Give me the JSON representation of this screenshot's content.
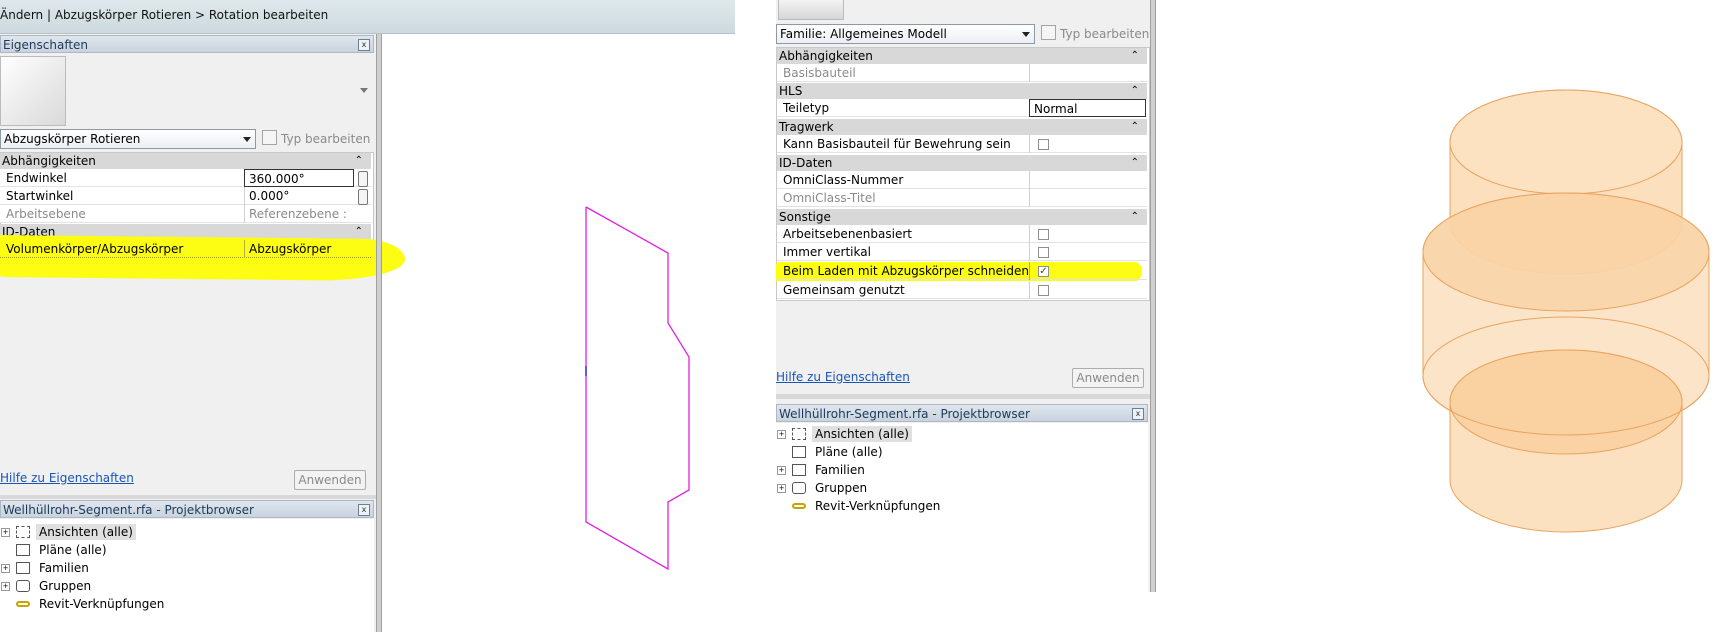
{
  "left_window": {
    "title": "Ändern | Abzugskörper Rotieren > Rotation bearbeiten",
    "properties_header": "Eigenschaften",
    "type_selector": "Abzugskörper Rotieren",
    "edit_type": "Typ bearbeiten",
    "groups": {
      "constraints": "Abhängigkeiten",
      "id_data": "ID-Daten"
    },
    "params": {
      "end_angle": {
        "label": "Endwinkel",
        "value": "360.000°"
      },
      "start_angle": {
        "label": "Startwinkel",
        "value": "0.000°"
      },
      "work_plane": {
        "label": "Arbeitsebene",
        "value": "Referenzebene : M..."
      },
      "solid_void": {
        "label": "Volumenkörper/Abzugskörper",
        "value": "Abzugskörper"
      }
    },
    "help_link": "Hilfe zu Eigenschaften",
    "apply": "Anwenden",
    "browser_header": "Wellhüllrohr-Segment.rfa - Projektbrowser",
    "tree": [
      "Ansichten (alle)",
      "Pläne (alle)",
      "Familien",
      "Gruppen",
      "Revit-Verknüpfungen"
    ]
  },
  "right_window": {
    "type_selector": "Familie: Allgemeines Modell",
    "edit_type": "Typ bearbeiten",
    "groups": {
      "constraints": "Abhängigkeiten",
      "mep": "HLS",
      "structure": "Tragwerk",
      "id_data": "ID-Daten",
      "other": "Sonstige"
    },
    "params": {
      "host": {
        "label": "Basisbauteil",
        "value": ""
      },
      "part_type": {
        "label": "Teiletyp",
        "value": "Normal"
      },
      "rebar_host": {
        "label": "Kann Basisbauteil für Bewehrung sein",
        "checked": false
      },
      "omniclass_number": {
        "label": "OmniClass-Nummer",
        "value": ""
      },
      "omniclass_title": {
        "label": "OmniClass-Titel",
        "value": ""
      },
      "workplane_based": {
        "label": "Arbeitsebenenbasiert",
        "checked": false
      },
      "always_vertical": {
        "label": "Immer vertikal",
        "checked": false
      },
      "cut_with_voids": {
        "label": "Beim Laden mit Abzugskörper schneiden",
        "checked": true
      },
      "shared": {
        "label": "Gemeinsam genutzt",
        "checked": false
      }
    },
    "help_link": "Hilfe zu Eigenschaften",
    "apply": "Anwenden",
    "browser_header": "Wellhüllrohr-Segment.rfa - Projektbrowser",
    "tree": [
      "Ansichten (alle)",
      "Pläne (alle)",
      "Familien",
      "Gruppen",
      "Revit-Verknüpfungen"
    ]
  },
  "colors": {
    "highlight": "#fdfd14",
    "sketch_line": "#e020e0",
    "solid_fill": "#fbd9b0",
    "solid_edge": "#e8a35f"
  }
}
